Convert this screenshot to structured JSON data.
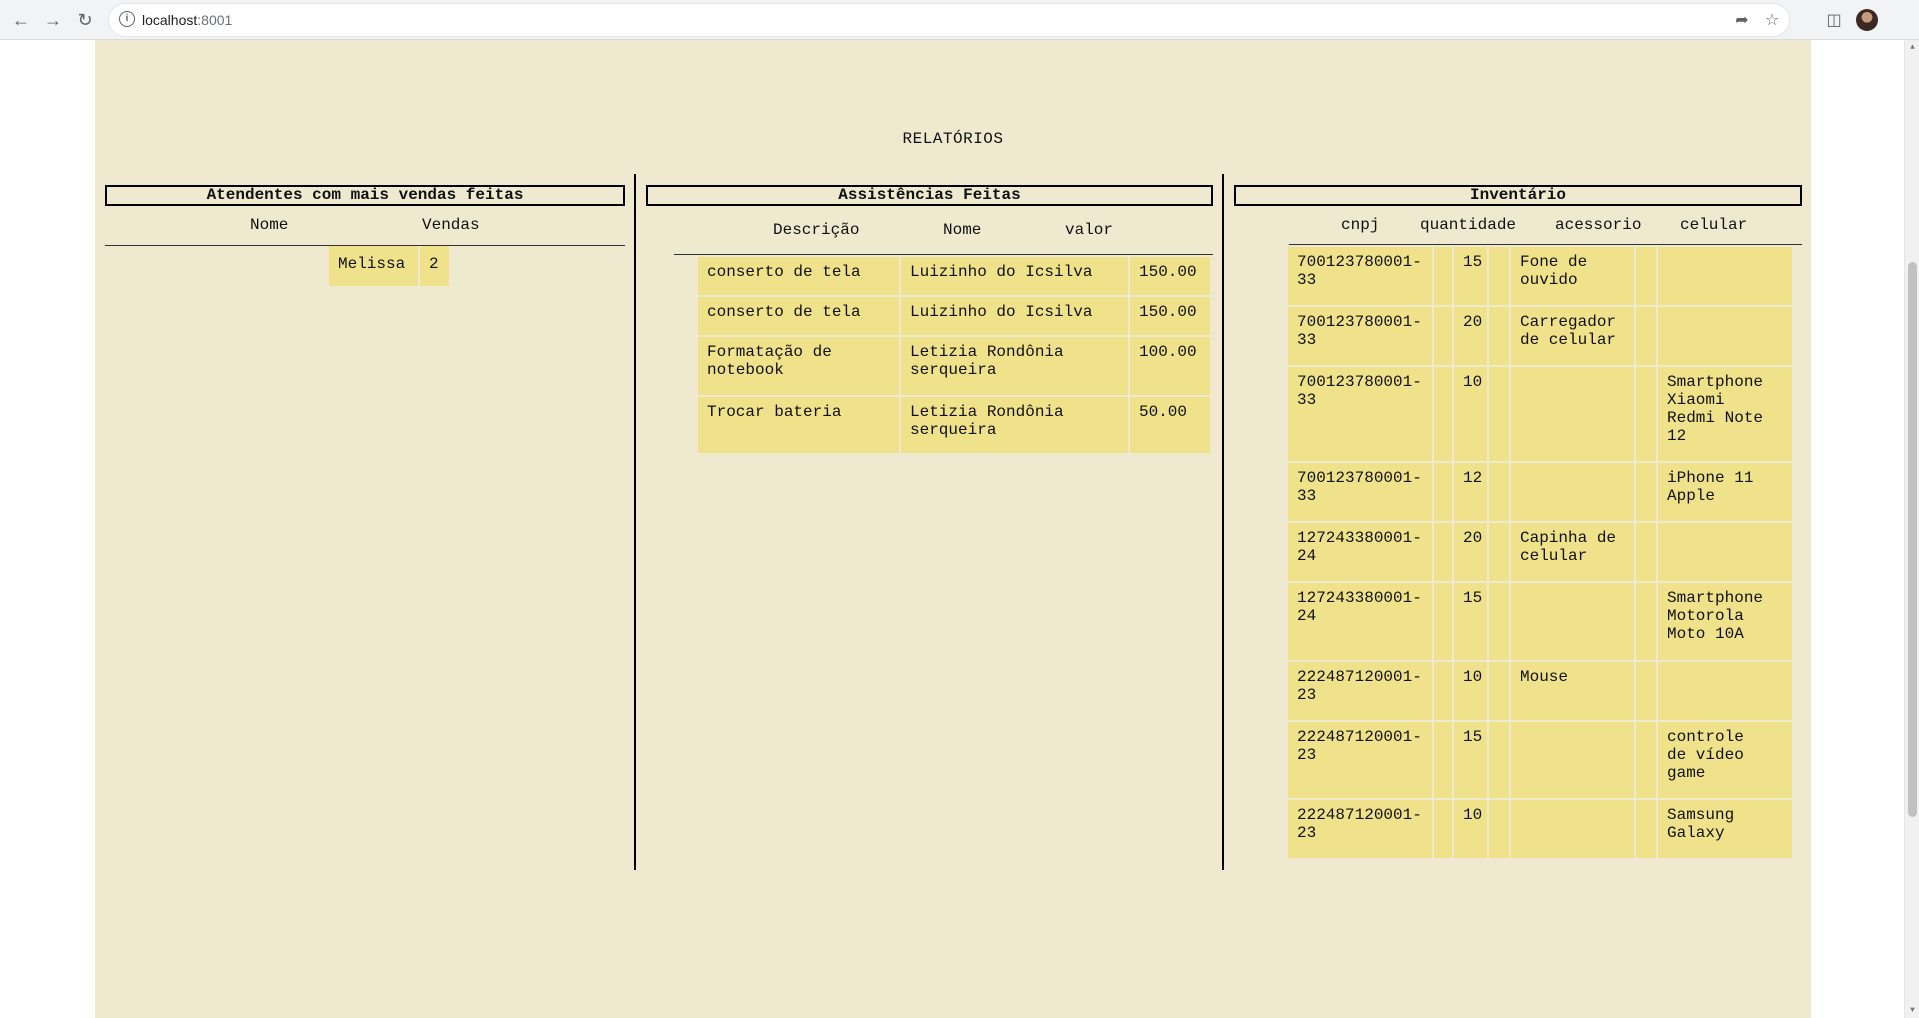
{
  "browser": {
    "url_host": "localhost",
    "url_port": ":8001"
  },
  "page": {
    "title": "RELATÓRIOS"
  },
  "attendants": {
    "title": "Atendentes com mais vendas feitas",
    "headers": [
      "Nome",
      "Vendas"
    ],
    "rows": [
      [
        "Melissa",
        "2"
      ]
    ]
  },
  "services": {
    "title": "Assistências Feitas",
    "headers": [
      "Descrição",
      "Nome",
      "valor"
    ],
    "rows": [
      [
        "conserto de tela",
        "Luizinho do Icsilva",
        "150.00"
      ],
      [
        "conserto de tela",
        "Luizinho do Icsilva",
        "150.00"
      ],
      [
        "Formatação de\nnotebook",
        "Letizia Rondônia\nserqueira",
        "100.00"
      ],
      [
        "Trocar bateria",
        "Letizia Rondônia\nserqueira",
        "50.00"
      ]
    ]
  },
  "inventory": {
    "title": "Inventário",
    "headers": [
      "cnpj",
      "quantidade",
      "acessorio",
      "celular"
    ],
    "rows": [
      [
        "700123780001-\n33",
        "15",
        "Fone de\nouvido",
        ""
      ],
      [
        "700123780001-\n33",
        "20",
        "Carregador\nde celular",
        ""
      ],
      [
        "700123780001-\n33",
        "10",
        "",
        "Smartphone\nXiaomi\nRedmi Note\n12"
      ],
      [
        "700123780001-\n33",
        "12",
        "",
        "iPhone 11\nApple"
      ],
      [
        "127243380001-\n24",
        "20",
        "Capinha de\ncelular",
        ""
      ],
      [
        "127243380001-\n24",
        "15",
        "",
        "Smartphone\nMotorola\nMoto 10A"
      ],
      [
        "222487120001-\n23",
        "10",
        "Mouse",
        ""
      ],
      [
        "222487120001-\n23",
        "15",
        "",
        "controle\nde vídeo\ngame"
      ],
      [
        "222487120001-\n23",
        "10",
        "",
        "Samsung\nGalaxy"
      ]
    ]
  }
}
